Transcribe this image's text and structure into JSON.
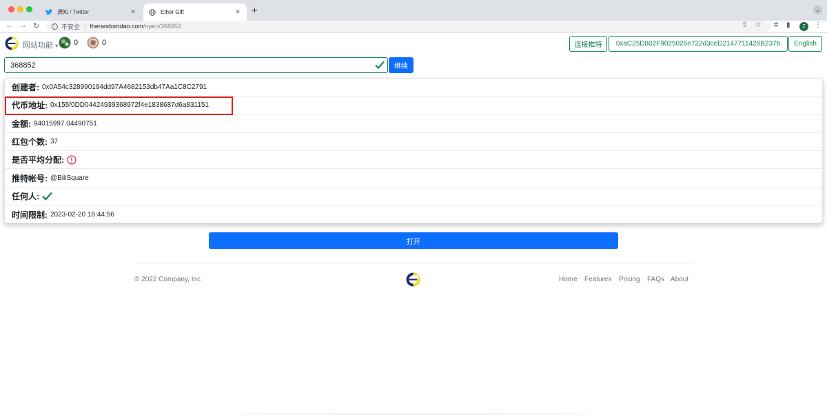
{
  "browser": {
    "tabs": [
      {
        "title": "通知 / Twitter",
        "icon": "twitter-icon",
        "active": false
      },
      {
        "title": "Ether Gift",
        "icon": "globe-icon",
        "active": true
      }
    ],
    "new_tab": "+",
    "insecure_label": "不安全",
    "url_host": "therandomdao.com",
    "url_path": "/open/368852",
    "profile_initial": "Z"
  },
  "header": {
    "features_menu": "网站功能",
    "token1_count": "0",
    "token2_count": "0",
    "connect_twitter": "连接推特",
    "wallet_address": "0xaC25D802F9025026e722d3ceD2147711426B237b",
    "language": "English"
  },
  "search": {
    "value": "368852",
    "continue_label": "继续"
  },
  "details": {
    "rows": [
      {
        "label": "创建者:",
        "value": "0x0A54c328990194dd97A4682153db47Aa1C8C2791"
      },
      {
        "label": "代币地址:",
        "value": "0x155f0DD04424939368972f4e1838687d6a831151"
      },
      {
        "label": "金额:",
        "value": "94015997.04490751"
      },
      {
        "label": "红包个数:",
        "value": "37"
      },
      {
        "label": "是否平均分配:",
        "value": ""
      },
      {
        "label": "推特帐号:",
        "value": "@BiliSquare"
      },
      {
        "label": "任何人:",
        "value": ""
      },
      {
        "label": "时间限制:",
        "value": "2023-02-20 16:44:56"
      }
    ]
  },
  "open_label": "打开",
  "footer": {
    "copyright": "© 2022 Company, Inc",
    "links": [
      "Home",
      "Features",
      "Pricing",
      "FAQs",
      "About"
    ]
  },
  "colors": {
    "primary": "#0d6efd",
    "success": "#198754",
    "danger": "#dc3545",
    "highlight": "#e0241b"
  }
}
